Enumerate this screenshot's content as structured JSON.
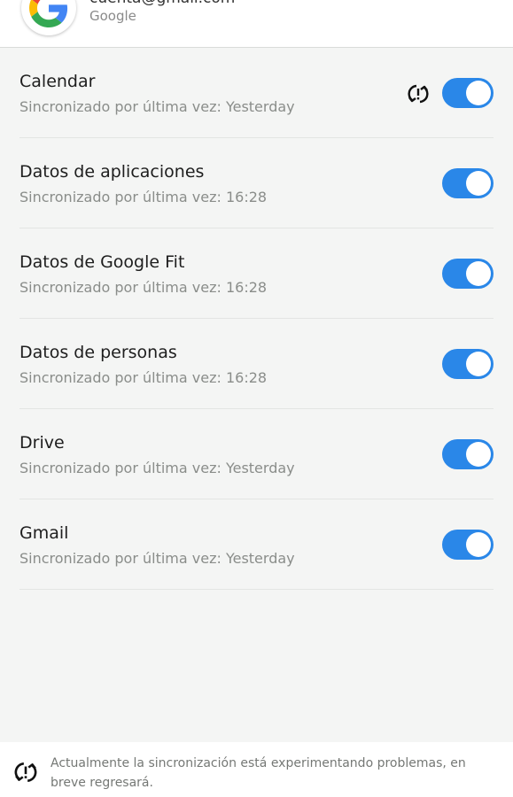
{
  "account": {
    "email": "cuenta@gmail.com",
    "provider": "Google",
    "logo_icon": "google-logo-icon"
  },
  "sync_items": [
    {
      "title": "Calendar",
      "subtitle": "Sincronizado por última vez: Yesterday",
      "enabled": true,
      "status_icon": "sync-problem-icon"
    },
    {
      "title": "Datos de aplicaciones",
      "subtitle": "Sincronizado por última vez: 16:28",
      "enabled": true
    },
    {
      "title": "Datos de Google Fit",
      "subtitle": "Sincronizado por última vez: 16:28",
      "enabled": true
    },
    {
      "title": "Datos de personas",
      "subtitle": "Sincronizado por última vez: 16:28",
      "enabled": true
    },
    {
      "title": "Drive",
      "subtitle": "Sincronizado por última vez: Yesterday",
      "enabled": true
    },
    {
      "title": "Gmail",
      "subtitle": "Sincronizado por última vez: Yesterday",
      "enabled": true
    }
  ],
  "footer": {
    "icon": "sync-problem-icon",
    "message": "Actualmente la sincronización está experimentando problemas, en breve regresará."
  },
  "colors": {
    "toggle_on": "#2a87e8",
    "background": "#f4f5f4"
  }
}
